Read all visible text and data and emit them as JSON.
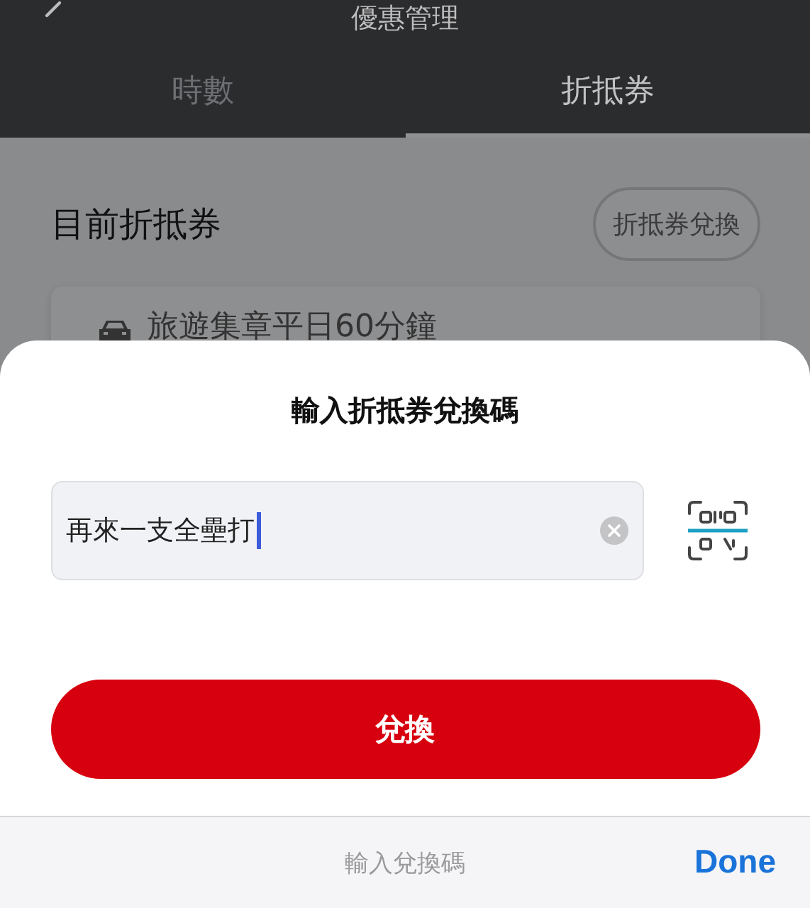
{
  "header": {
    "title": "優惠管理"
  },
  "tabs": [
    {
      "label": "時數",
      "selected": false
    },
    {
      "label": "折抵券",
      "selected": true
    }
  ],
  "section": {
    "title": "目前折抵券",
    "action": "折抵券兌換"
  },
  "coupons": [
    {
      "name": "旅遊集章平日60分鐘"
    }
  ],
  "sheet": {
    "title": "輸入折抵券兌換碼",
    "field": {
      "value": "再來一支全壘打",
      "focused": true
    },
    "submit": "兌換"
  },
  "keyboard_toolbar": {
    "hint": "輸入兌換碼",
    "done": "Done"
  }
}
